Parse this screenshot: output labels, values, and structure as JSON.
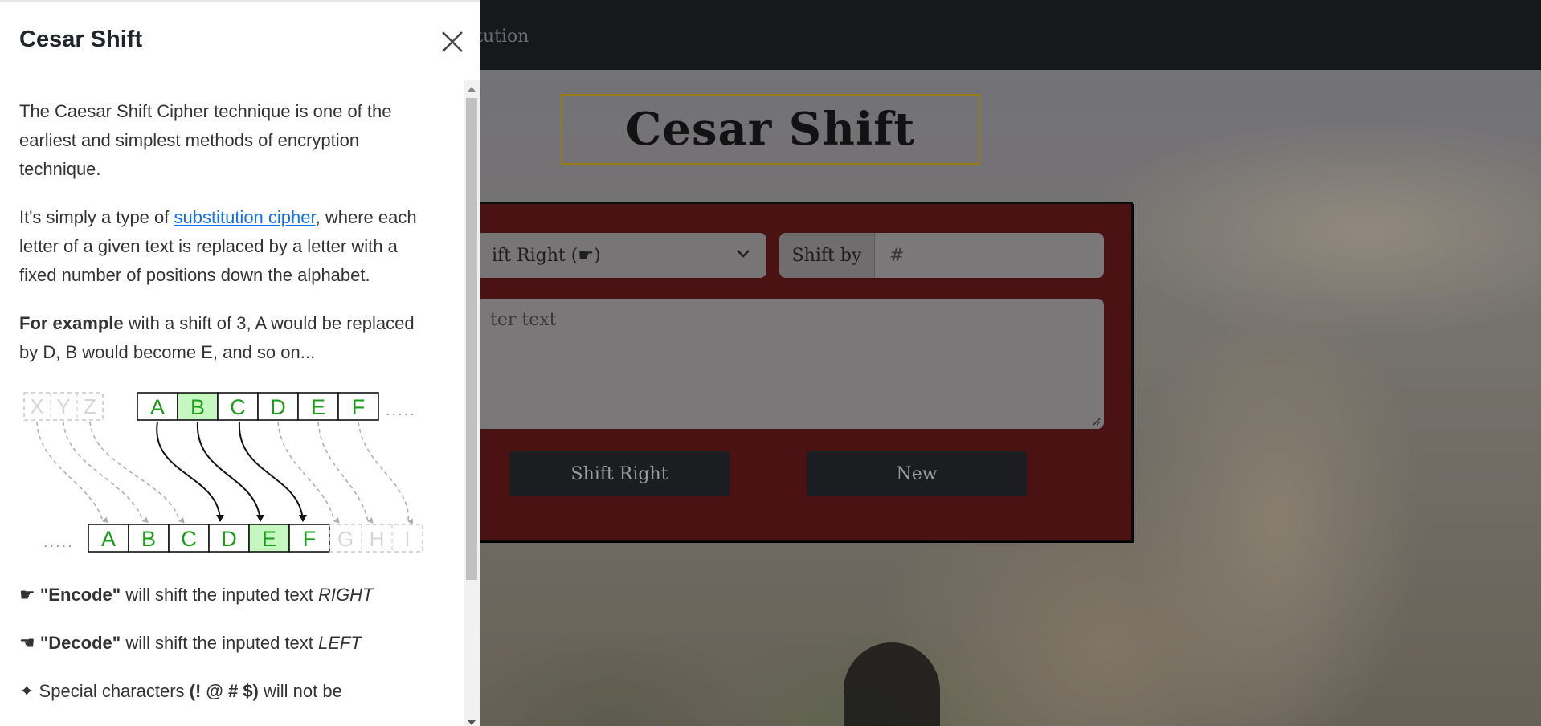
{
  "header": {
    "nav_link": "stitution"
  },
  "main": {
    "title": "Cesar Shift",
    "direction_select": "ift Right (☛)",
    "shift_by_label": "Shift by",
    "shift_by_placeholder": "#",
    "text_placeholder": "ter text",
    "shift_button": "Shift Right",
    "new_button": "New"
  },
  "drawer": {
    "title": "Cesar Shift",
    "p1": "The Caesar Shift Cipher technique is one of the earliest and simplest methods of encryption technique.",
    "p2_before": "It's simply a type of ",
    "p2_link": "substitution cipher",
    "p2_after": ", where each letter of a given text is replaced by a letter with a fixed number of positions down the alphabet.",
    "p3_bold": "For example",
    "p3_rest": " with a shift of 3, A would be replaced by D, B would become E, and so on...",
    "encode_glyph": "☛",
    "encode_bold": "\"Encode\"",
    "encode_text": " will shift the inputed text ",
    "encode_em": "RIGHT",
    "decode_glyph": "☚",
    "decode_bold": "\"Decode\"",
    "decode_text": " will shift the inputed text ",
    "decode_em": "LEFT",
    "special_glyph": "✦",
    "special_text": " Special characters ",
    "special_bold": "(! @ # $)",
    "special_after": " will not be"
  },
  "diagram": {
    "top_faded": [
      "X",
      "Y",
      "Z"
    ],
    "top_letters": [
      "A",
      "B",
      "C",
      "D",
      "E",
      "F"
    ],
    "top_dots": ".....",
    "bottom_dots": ".....",
    "bottom_letters": [
      "A",
      "B",
      "C",
      "D",
      "E",
      "F"
    ],
    "bottom_faded": [
      "G",
      "H",
      "I"
    ]
  },
  "colors": {
    "letter_green": "#1a9e1a",
    "highlight_fill": "#c7f7c0",
    "panel_bg": "#4a1213",
    "title_border": "#9a7a12"
  }
}
